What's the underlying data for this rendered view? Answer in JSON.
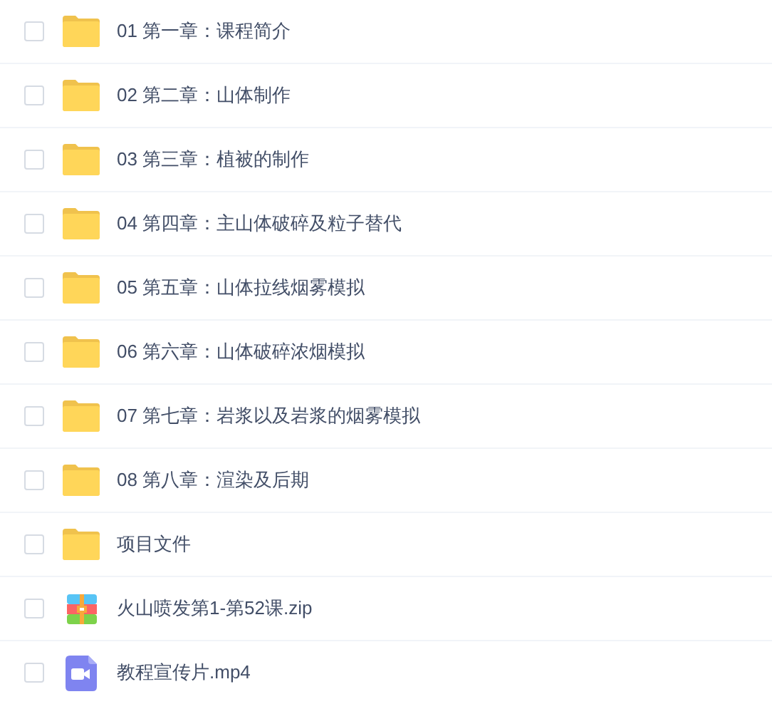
{
  "files": [
    {
      "kind": "folder",
      "name": "01 第一章：课程简介",
      "checked": false
    },
    {
      "kind": "folder",
      "name": "02 第二章：山体制作",
      "checked": false
    },
    {
      "kind": "folder",
      "name": "03 第三章：植被的制作",
      "checked": false
    },
    {
      "kind": "folder",
      "name": "04 第四章：主山体破碎及粒子替代",
      "checked": false
    },
    {
      "kind": "folder",
      "name": "05 第五章：山体拉线烟雾模拟",
      "checked": false
    },
    {
      "kind": "folder",
      "name": "06 第六章：山体破碎浓烟模拟",
      "checked": false
    },
    {
      "kind": "folder",
      "name": "07 第七章：岩浆以及岩浆的烟雾模拟",
      "checked": false
    },
    {
      "kind": "folder",
      "name": "08 第八章：渲染及后期",
      "checked": false
    },
    {
      "kind": "folder",
      "name": "项目文件",
      "checked": false
    },
    {
      "kind": "archive",
      "name": "火山喷发第1-第52课.zip",
      "checked": false
    },
    {
      "kind": "video",
      "name": "教程宣传片.mp4",
      "checked": false
    }
  ]
}
